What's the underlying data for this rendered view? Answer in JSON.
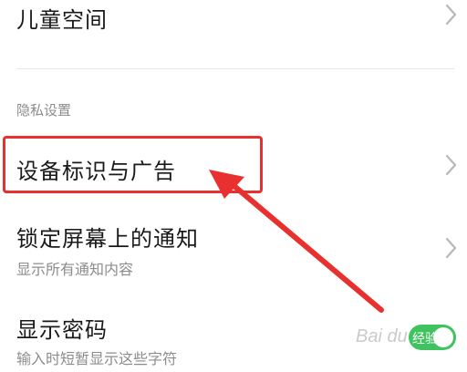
{
  "settings": {
    "kid_space": {
      "title": "儿童空间"
    },
    "privacy_section": {
      "header": "隐私设置"
    },
    "device_id_ads": {
      "title": "设备标识与广告"
    },
    "lock_screen_notif": {
      "title": "锁定屏幕上的通知",
      "subtitle": "显示所有通知内容"
    },
    "show_password": {
      "title": "显示密码",
      "subtitle": "输入时短暂显示这些字符",
      "toggle_on": true
    }
  },
  "overlay": {
    "toggle_watermark": "经验",
    "watermark": "Bai du"
  },
  "colors": {
    "highlight": "#e8302f",
    "toggle_on": "#3fc35f",
    "text_primary": "#1a1a1a",
    "text_secondary": "#8c8c8c"
  },
  "icons": {
    "row_chevron": "chevron-right-icon",
    "annotation": "red-arrow"
  }
}
